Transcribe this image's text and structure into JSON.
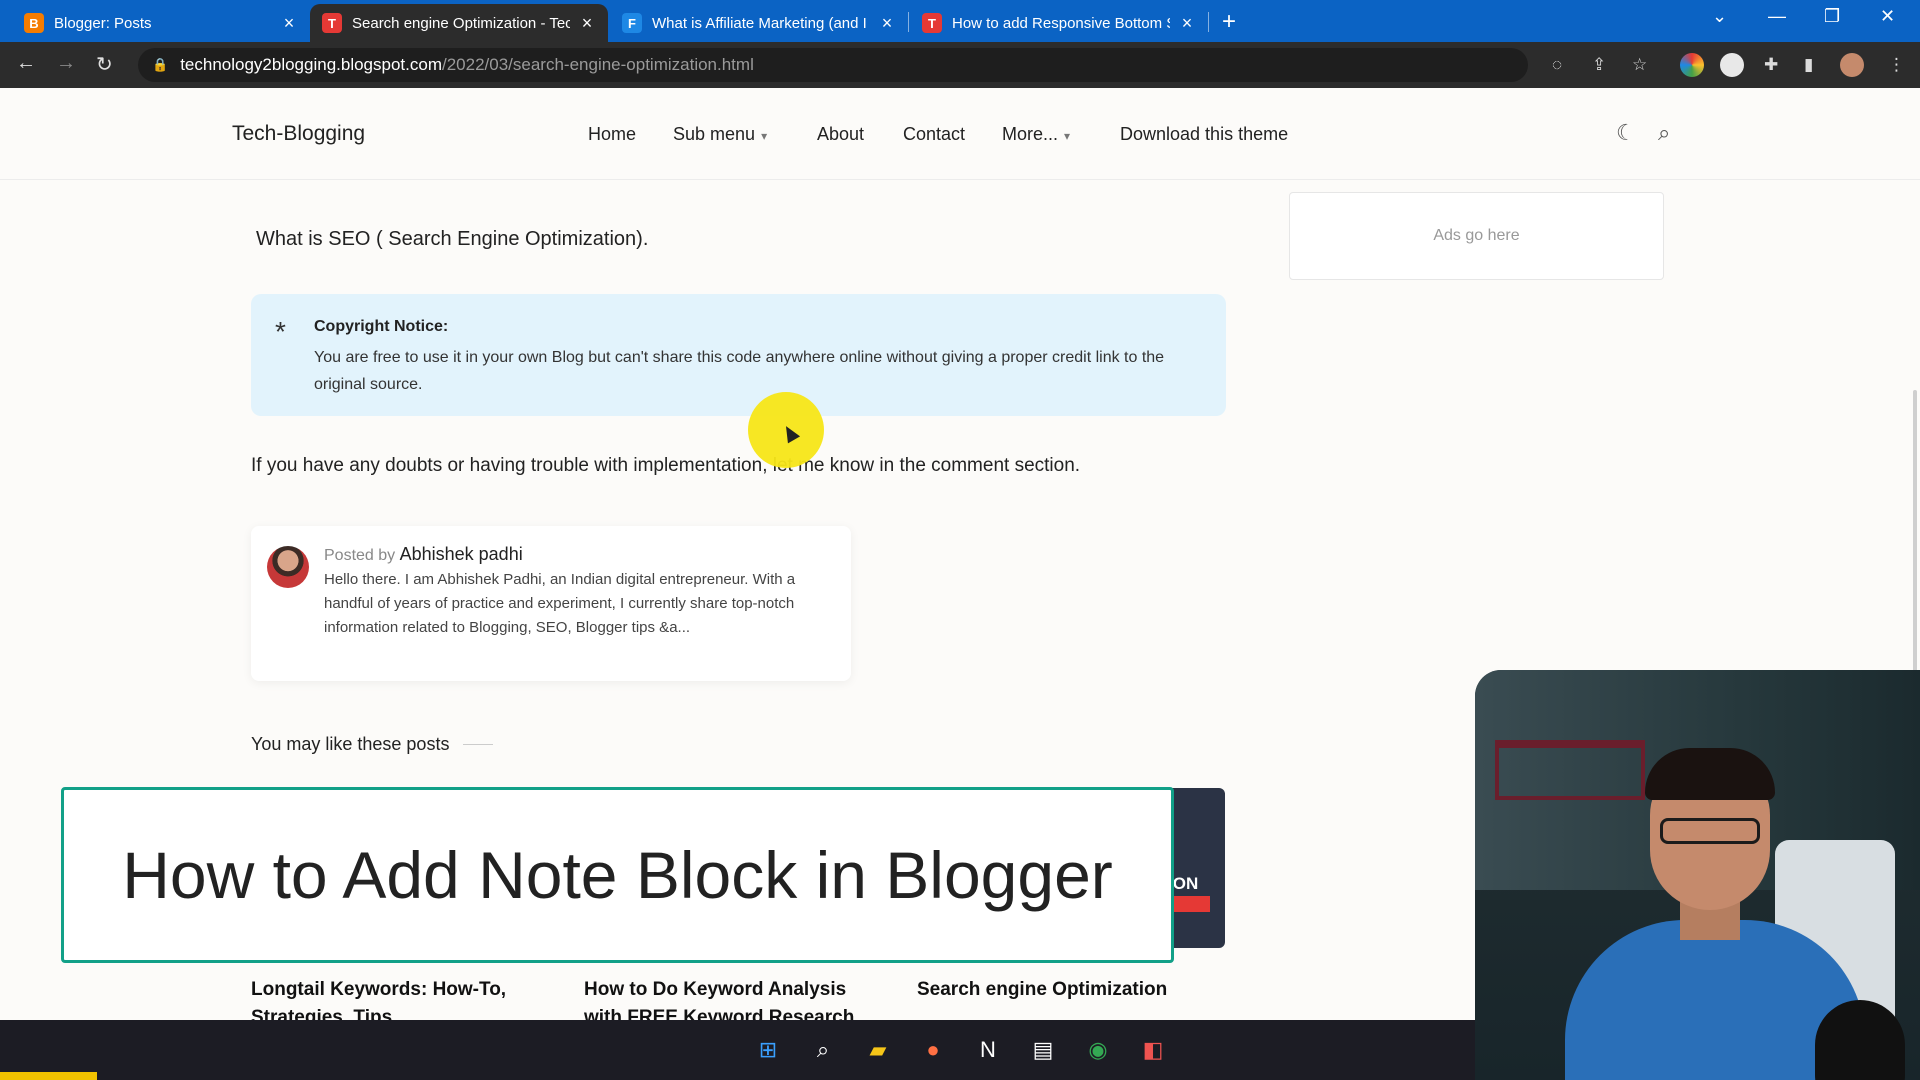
{
  "browser": {
    "tabs": [
      {
        "title": "Blogger: Posts",
        "favicon_letter": "B",
        "favicon_color": "#f57c00",
        "close": "×"
      },
      {
        "title": "Search engine Optimization - Tec",
        "favicon_letter": "T",
        "favicon_color": "#e53935",
        "close": "×"
      },
      {
        "title": "What is Affiliate Marketing (and I",
        "favicon_letter": "F",
        "favicon_color": "#1e88e5",
        "close": "×"
      },
      {
        "title": "How to add Responsive Bottom S",
        "favicon_letter": "T",
        "favicon_color": "#e53935",
        "close": "×"
      }
    ],
    "new_tab": "+",
    "window_controls": {
      "dropdown": "⌄",
      "minimize": "—",
      "restore": "❐",
      "close": "✕"
    },
    "url_host": "technology2blogging.blogspot.com",
    "url_path": "/2022/03/search-engine-optimization.html"
  },
  "site": {
    "logo": "Tech-Blogging",
    "nav": {
      "home": "Home",
      "sub_menu": "Sub menu",
      "about": "About",
      "contact": "Contact",
      "more": "More...",
      "download": "Download this theme"
    },
    "ads_label": "Ads go here"
  },
  "article": {
    "subtitle": "What is SEO ( Search Engine Optimization).",
    "note": {
      "star": "*",
      "heading": "Copyright Notice:",
      "body": "You are free to use it in your own Blog but can't share this code anywhere online without giving a proper credit link to the original source."
    },
    "doubts": "If you have any doubts or having trouble with implementation, let me know in the comment section.",
    "author": {
      "posted_by": "Posted by",
      "name": "Abhishek padhi",
      "bio": "Hello there. I am Abhishek Padhi, an Indian digital entrepreneur. With a handful of years of practice and experiment, I currently share top-notch information related to Blogging, SEO, Blogger tips &a..."
    },
    "related_heading": "You may like these posts",
    "related_posts": [
      "Longtail Keywords: How-To, Strategies, Tips",
      "How to Do Keyword Analysis with FREE Keyword Research",
      "Search engine Optimization"
    ],
    "thumb_text": "ION"
  },
  "overlay": {
    "title": "How to Add Note Block in Blogger"
  }
}
